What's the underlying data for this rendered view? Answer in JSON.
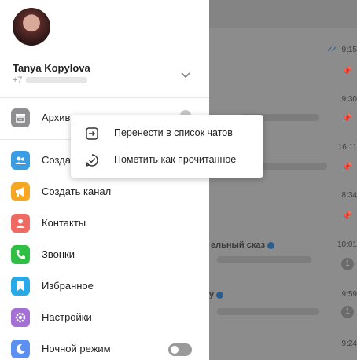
{
  "drawer": {
    "user": {
      "name": "Tanya Kopylova",
      "phone_prefix": "+7"
    },
    "items": [
      {
        "label": "Архив",
        "icon": "archive-icon",
        "color": "#8e8e93"
      },
      {
        "label": "Созда",
        "icon": "group-icon",
        "color": "#3a9ce3"
      },
      {
        "label": "Создать канал",
        "icon": "megaphone-icon",
        "color": "#f5a623"
      },
      {
        "label": "Контакты",
        "icon": "person-icon",
        "color": "#ef6a62"
      },
      {
        "label": "Звонки",
        "icon": "phone-icon",
        "color": "#2fbf44"
      },
      {
        "label": "Избранное",
        "icon": "bookmark-icon",
        "color": "#2aa9e6"
      },
      {
        "label": "Настройки",
        "icon": "gear-icon",
        "color": "#a56fd6"
      },
      {
        "label": "Ночной режим",
        "icon": "moon-icon",
        "color": "#5b8ff0"
      }
    ],
    "night_mode_on": false
  },
  "context_menu": {
    "items": [
      {
        "label": "Перенести в список чатов",
        "icon": "move-to-chats-icon"
      },
      {
        "label": "Пометить как прочитанное",
        "icon": "check-circle-icon"
      }
    ]
  },
  "chat_list": {
    "times": [
      "9:15",
      "9:30",
      "16:11",
      "8:34",
      "10:01",
      "9:59",
      "9:24"
    ],
    "badges": [
      "1",
      "1"
    ],
    "visible_name_fragment": "ельный сказ",
    "visible_name_fragment_2": "у"
  }
}
